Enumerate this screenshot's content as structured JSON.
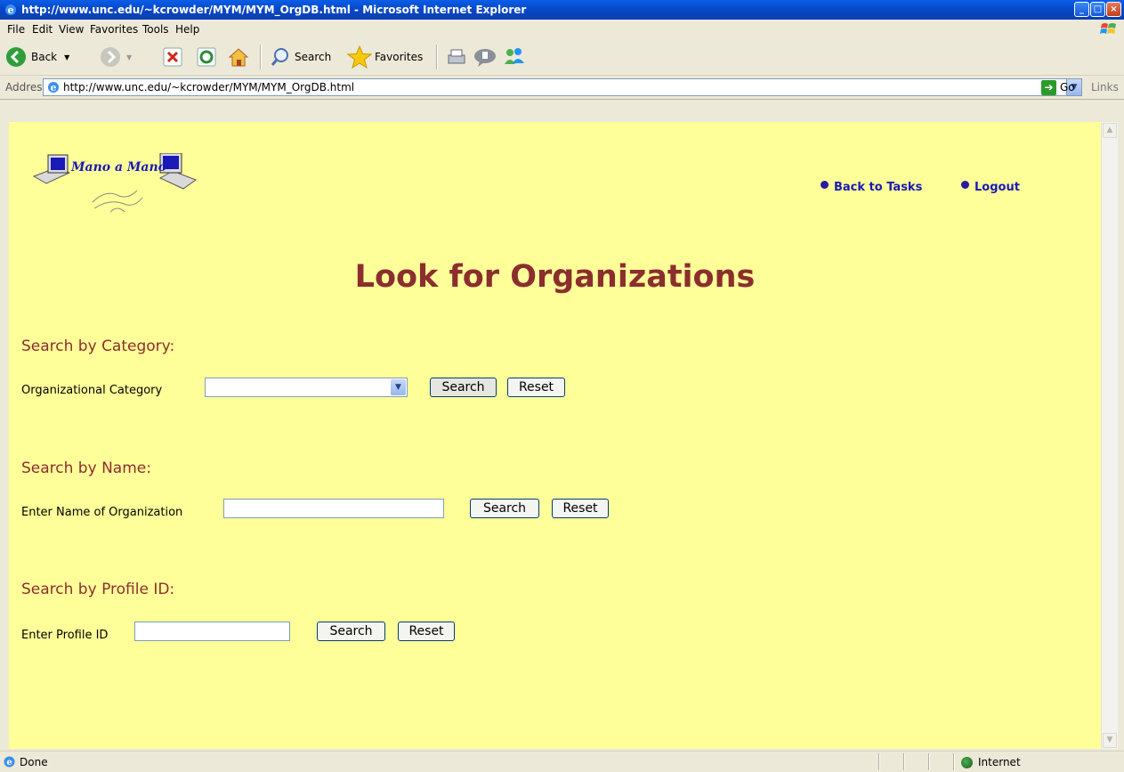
{
  "window": {
    "title": "http://www.unc.edu/~kcrowder/MYM/MYM_OrgDB.html - Microsoft Internet Explorer"
  },
  "menu": [
    "File",
    "Edit",
    "View",
    "Favorites",
    "Tools",
    "Help"
  ],
  "toolbar": {
    "back_label": "Back",
    "search_label": "Search",
    "favorites_label": "Favorites"
  },
  "address": {
    "label": "Address",
    "url": "http://www.unc.edu/~kcrowder/MYM/MYM_OrgDB.html",
    "go_label": "Go",
    "links_label": "Links"
  },
  "page": {
    "logo_text": "Mano a Mano",
    "nav": {
      "back_to_tasks": "Back to Tasks",
      "logout": "Logout"
    },
    "title": "Look for Organizations",
    "category_section": {
      "heading": "Search by Category:",
      "label": "Organizational Category",
      "selected_value": "",
      "search_label": "Search",
      "reset_label": "Reset"
    },
    "name_section": {
      "heading": "Search by Name:",
      "label": "Enter Name of Organization",
      "value": "",
      "search_label": "Search",
      "reset_label": "Reset"
    },
    "profile_section": {
      "heading": "Search by Profile ID:",
      "label": "Enter Profile ID",
      "value": "",
      "search_label": "Search",
      "reset_label": "Reset"
    }
  },
  "status": {
    "text": "Done",
    "zone": "Internet"
  },
  "colors": {
    "page_background": "#ffff99",
    "heading_color": "#8b2e2e",
    "link_color": "#1a1ab8"
  }
}
